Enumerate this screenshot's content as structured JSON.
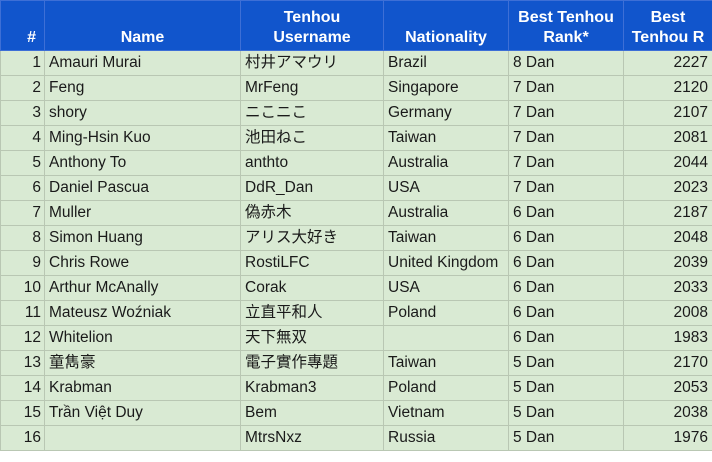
{
  "headers": {
    "num": "#",
    "name": "Name",
    "username": "Tenhou Username",
    "nationality": "Nationality",
    "rank": "Best Tenhou Rank*",
    "r": "Best Tenhou R"
  },
  "rows": [
    {
      "num": "1",
      "name": "Amauri Murai",
      "username": "村井アマウリ",
      "nationality": "Brazil",
      "rank": "8 Dan",
      "r": "2227"
    },
    {
      "num": "2",
      "name": "Feng",
      "username": "MrFeng",
      "nationality": "Singapore",
      "rank": "7 Dan",
      "r": "2120"
    },
    {
      "num": "3",
      "name": "shory",
      "username": "ニこニこ",
      "nationality": "Germany",
      "rank": "7 Dan",
      "r": "2107"
    },
    {
      "num": "4",
      "name": "Ming-Hsin Kuo",
      "username": "池田ねこ",
      "nationality": "Taiwan",
      "rank": "7 Dan",
      "r": "2081"
    },
    {
      "num": "5",
      "name": "Anthony To",
      "username": "anthto",
      "nationality": "Australia",
      "rank": "7 Dan",
      "r": "2044"
    },
    {
      "num": "6",
      "name": "Daniel Pascua",
      "username": "DdR_Dan",
      "nationality": "USA",
      "rank": "7 Dan",
      "r": "2023"
    },
    {
      "num": "7",
      "name": "Muller",
      "username": "偽赤木",
      "nationality": "Australia",
      "rank": "6 Dan",
      "r": "2187"
    },
    {
      "num": "8",
      "name": "Simon Huang",
      "username": "アリス大好き",
      "nationality": "Taiwan",
      "rank": "6 Dan",
      "r": "2048"
    },
    {
      "num": "9",
      "name": "Chris Rowe",
      "username": "RostiLFC",
      "nationality": "United Kingdom",
      "rank": "6 Dan",
      "r": "2039"
    },
    {
      "num": "10",
      "name": "Arthur McAnally",
      "username": "Corak",
      "nationality": "USA",
      "rank": "6 Dan",
      "r": "2033"
    },
    {
      "num": "11",
      "name": "Mateusz Woźniak",
      "username": "立直平和人",
      "nationality": "Poland",
      "rank": "6 Dan",
      "r": "2008"
    },
    {
      "num": "12",
      "name": "Whitelion",
      "username": "天下無双",
      "nationality": "",
      "rank": "6 Dan",
      "r": "1983"
    },
    {
      "num": "13",
      "name": "童雋豪",
      "username": "電子實作專題",
      "nationality": "Taiwan",
      "rank": "5 Dan",
      "r": "2170"
    },
    {
      "num": "14",
      "name": "Krabman",
      "username": "Krabman3",
      "nationality": "Poland",
      "rank": "5 Dan",
      "r": "2053"
    },
    {
      "num": "15",
      "name": "Trần Việt Duy",
      "username": "Bem",
      "nationality": "Vietnam",
      "rank": "5 Dan",
      "r": "2038"
    },
    {
      "num": "16",
      "name": "",
      "username": "MtrsNxz",
      "nationality": "Russia",
      "rank": "5 Dan",
      "r": "1976"
    }
  ]
}
